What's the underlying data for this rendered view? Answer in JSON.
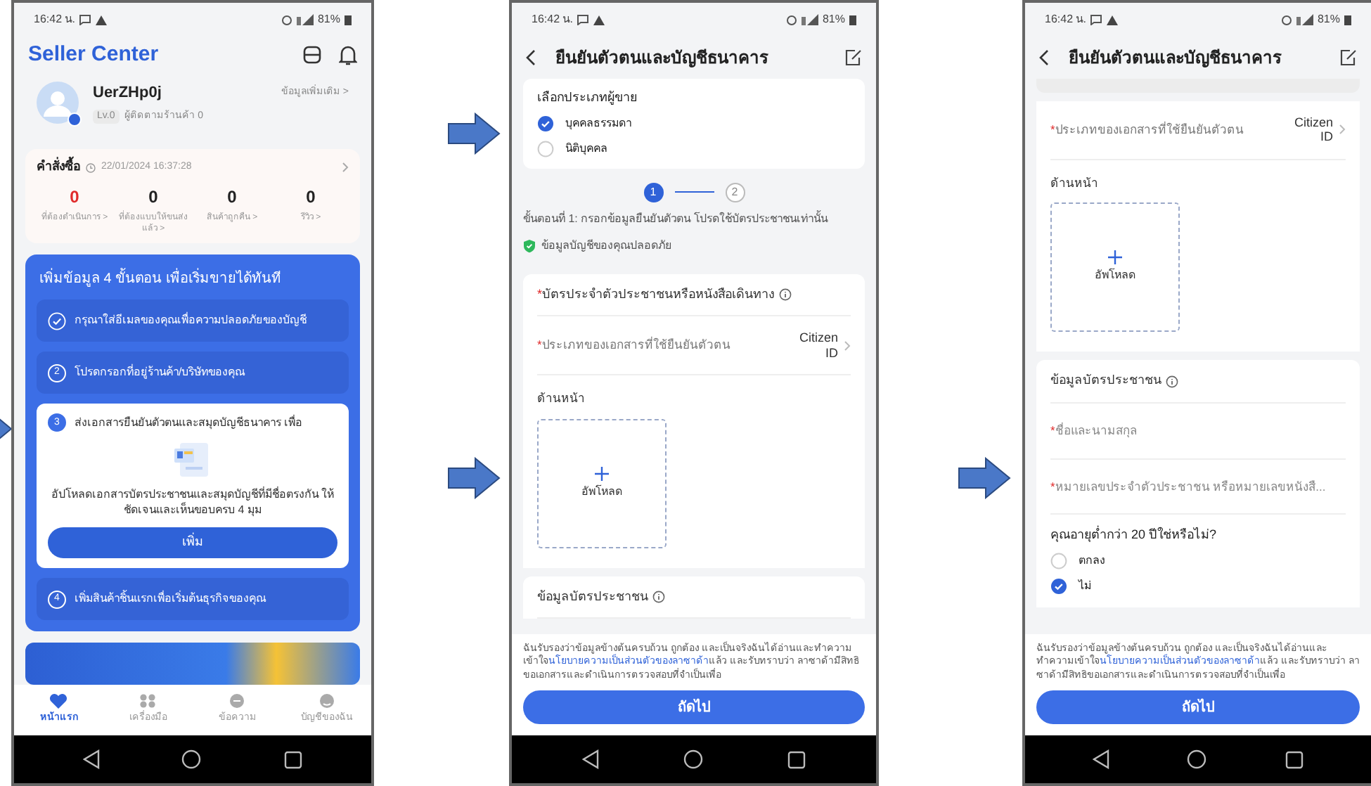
{
  "screens": [
    {
      "kind": "home",
      "status_bar": {
        "time": "16:42 น.",
        "battery": "81%"
      },
      "app_title": "Seller Center",
      "profile": {
        "name": "UerZHp0j",
        "level": "Lv.0",
        "followers": "ผู้ติดตามร้านค้า 0",
        "more": "ข้อมูลเพิ่มเติม >"
      },
      "orders": {
        "title": "คำสั่งซื้อ",
        "updated": "22/01/2024 16:37:28",
        "stats": [
          {
            "value": "0",
            "label": "ที่ต้องดำเนินการ >",
            "highlight": true
          },
          {
            "value": "0",
            "label": "ที่ต้องแบบให้ขนส่งแล้ว >",
            "highlight": false
          },
          {
            "value": "0",
            "label": "สินค้าถูกคืน >",
            "highlight": false
          },
          {
            "value": "0",
            "label": "รีวิว >",
            "highlight": false
          }
        ]
      },
      "onboarding": {
        "title": "เพิ่มข้อมูล 4 ขั้นตอน เพื่อเริ่มขายได้ทันที",
        "steps": [
          {
            "kind": "done",
            "text": "กรุณาใส่อีเมลของคุณเพื่อความปลอดภัยของบัญชี"
          },
          {
            "kind": "pending",
            "number": "2",
            "text": "โปรดกรอกที่อยู่ร้านค้า/บริษัทของคุณ"
          },
          {
            "kind": "active",
            "number": "3",
            "text": "ส่งเอกสารยืนยันตัวตนและสมุดบัญชีธนาคาร เพื่อ",
            "description": "อัปโหลดเอกสารบัตรประชาชนและสมุดบัญชีที่มีชื่อตรงกัน ให้ชัดเจนและเห็นขอบครบ 4 มุม",
            "button": "เพิ่ม"
          },
          {
            "kind": "pending",
            "number": "4",
            "text": "เพิ่มสินค้าชิ้นแรกเพื่อเริ่มต้นธุรกิจของคุณ"
          }
        ]
      },
      "nav": [
        {
          "label": "หน้าแรก",
          "selected": true
        },
        {
          "label": "เครื่องมือ",
          "selected": false
        },
        {
          "label": "ข้อความ",
          "selected": false
        },
        {
          "label": "บัญชีของฉัน",
          "selected": false
        }
      ]
    },
    {
      "kind": "form",
      "status_bar": {
        "time": "16:42 น.",
        "battery": "81%"
      },
      "title": "ยืนยันตัวตนและบัญชีธนาคาร",
      "sections": [
        {
          "kind": "choice",
          "title": "เลือกประเภทผู้ขาย",
          "options": [
            {
              "label": "บุคคลธรรมดา",
              "selected": true
            },
            {
              "label": "นิติบุคคล",
              "selected": false
            }
          ]
        },
        {
          "kind": "stepper",
          "steps": [
            {
              "label": "1",
              "selected": true
            },
            {
              "label": "2",
              "selected": false
            }
          ]
        },
        {
          "kind": "note",
          "text": "ขั้นตอนที่ 1: กรอกข้อมูลยืนยันตัวตน โปรดใช้บัตรประชาชนเท่านั้น"
        },
        {
          "kind": "secure",
          "text": "ข้อมูลบัญชีของคุณปลอดภัย"
        },
        {
          "kind": "card_title",
          "mark": "*",
          "label": "บัตรประจำตัวประชาชนหรือหนังสือเดินทาง"
        },
        {
          "kind": "select",
          "mark": "*",
          "label": "ประเภทของเอกสารที่ใช้ยืนยันตัวตน",
          "value": "Citizen ID"
        },
        {
          "kind": "upload",
          "label": "ด้านหน้า",
          "button": "อัพโหลด"
        },
        {
          "kind": "card_title",
          "label": "ข้อมูลบัตรประชาชน"
        }
      ],
      "footer": {
        "before": "ฉันรับรองว่าข้อมูลข้างต้นครบถ้วน ถูกต้อง และเป็นจริงฉันได้อ่านและทำความเข้าใจ",
        "link": "นโยบายความเป็นส่วนตัวของลาซาด้า",
        "after": "แล้ว และรับทราบว่า ลาซาด้ามีสิทธิขอเอกสารและดำเนินการตรวจสอบที่จำเป็นเพื่อ",
        "button": "ถัดไป"
      }
    },
    {
      "kind": "form",
      "status_bar": {
        "time": "16:42 น.",
        "battery": "81%"
      },
      "title": "ยืนยันตัวตนและบัญชีธนาคาร",
      "sections": [
        {
          "kind": "cut_card"
        },
        {
          "kind": "select",
          "mark": "*",
          "label": "ประเภทของเอกสารที่ใช้ยืนยันตัวตน",
          "value": "Citizen ID"
        },
        {
          "kind": "upload",
          "label": "ด้านหน้า",
          "button": "อัพโหลด"
        },
        {
          "kind": "card_title",
          "label": "ข้อมูลบัตรประชาชน"
        },
        {
          "kind": "text_field",
          "mark": "*",
          "placeholder": "ชื่อและนามสกุล"
        },
        {
          "kind": "text_field",
          "mark": "*",
          "placeholder": "หมายเลขประจำตัวประชาชน หรือหมายเลขหนังสื..."
        },
        {
          "kind": "choice",
          "title": "คุณอายุต่ำกว่า 20 ปีใช่หรือไม่?",
          "options": [
            {
              "label": "ตกลง",
              "selected": false
            },
            {
              "label": "ไม่",
              "selected": true
            }
          ]
        }
      ],
      "footer": {
        "before": "ฉันรับรองว่าข้อมูลข้างต้นครบถ้วน ถูกต้อง และเป็นจริงฉันได้อ่านและทำความเข้าใจ",
        "link": "นโยบายความเป็นส่วนตัวของลาซาด้า",
        "after": "แล้ว และรับทราบว่า ลาซาด้ามีสิทธิขอเอกสารและดำเนินการตรวจสอบที่จำเป็นเพื่อ",
        "button": "ถัดไป"
      }
    }
  ]
}
